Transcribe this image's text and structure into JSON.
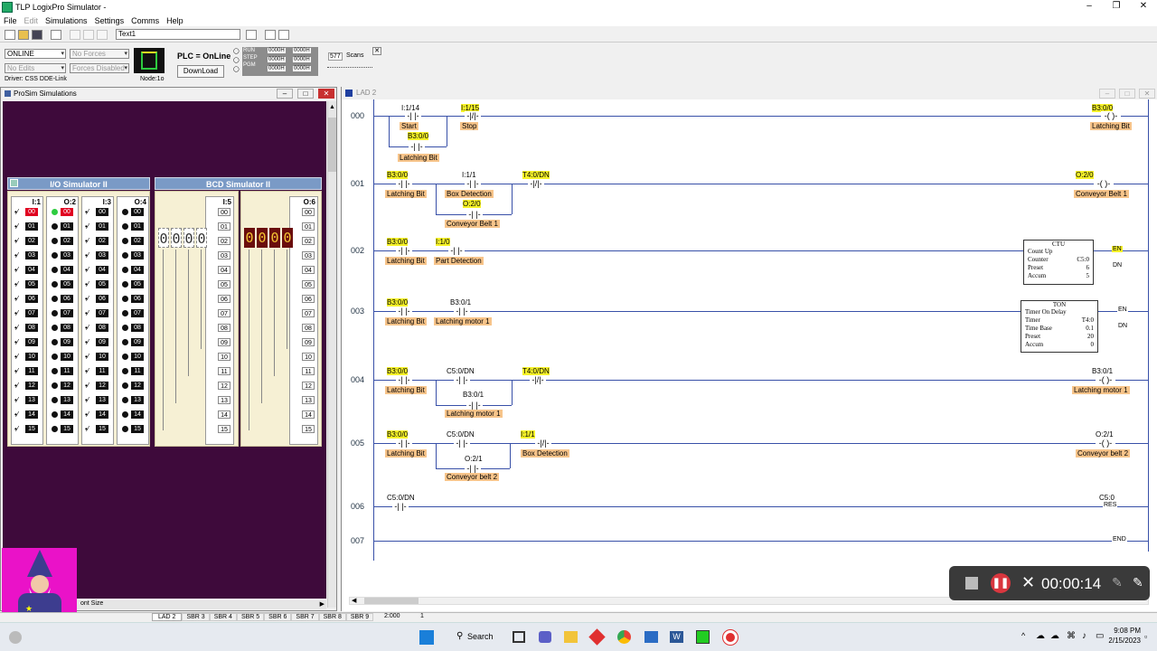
{
  "app": {
    "title": "TLP LogixPro Simulator  -"
  },
  "menu": [
    "File",
    "Edit",
    "Simulations",
    "Settings",
    "Comms",
    "Help"
  ],
  "toolbar": {
    "textbox": "Text1"
  },
  "status": {
    "mode": "ONLINE",
    "forces": "No Forces",
    "edits": "No Edits",
    "forces_disabled": "Forces Disabled",
    "driver": "Driver: CSS DDE-Link",
    "node": "Node:1o",
    "plc": "PLC = OnLine",
    "download": "DownLoad",
    "run": "RUN",
    "step": "STEP",
    "pgm": "PGM",
    "scans_count": "577",
    "scans_label": "Scans",
    "hex": [
      "0000H",
      "0000H",
      "0000H",
      "0000H",
      "0000H",
      "0000H"
    ]
  },
  "prosim": {
    "title": "ProSim Simulations",
    "io_title": "I/O Simulator II",
    "bcd_title": "BCD Simulator II",
    "io_cols": [
      {
        "hdr": "I:1",
        "type": "switch"
      },
      {
        "hdr": "O:2",
        "type": "led"
      },
      {
        "hdr": "I:3",
        "type": "switch"
      },
      {
        "hdr": "O:4",
        "type": "led"
      }
    ],
    "bcd_cols": [
      {
        "hdr": "I:5"
      },
      {
        "hdr": "O:6"
      }
    ],
    "bits": [
      "00",
      "01",
      "02",
      "03",
      "04",
      "05",
      "06",
      "07",
      "08",
      "09",
      "10",
      "11",
      "12",
      "13",
      "14",
      "15"
    ],
    "bcd_in": [
      "0",
      "0",
      "0",
      "0"
    ],
    "bcd_out": [
      "0",
      "0",
      "0",
      "0"
    ],
    "font_size_label": "ont Size"
  },
  "lad": {
    "title": "LAD 2",
    "rungs": [
      "000",
      "001",
      "002",
      "003",
      "004",
      "005",
      "006",
      "007"
    ],
    "r0": {
      "a1": "I:1/14",
      "d1": "Start",
      "a2": "B3:0/0",
      "d2": "Latching Bit",
      "a3": "I:1/15",
      "d3": "Stop",
      "a4": "B3:0/0",
      "d4": "Latching Bit"
    },
    "r1": {
      "a1": "B3:0/0",
      "d1": "Latching Bit",
      "a2": "I:1/1",
      "d2": "Box Detection",
      "a3": "O:2/0",
      "d3": "Conveyor Belt 1",
      "a4": "T4:0/DN",
      "a5": "O:2/0",
      "d5": "Conveyor Belt 1"
    },
    "r2": {
      "a1": "B3:0/0",
      "d1": "Latching Bit",
      "a2": "I:1/0",
      "d2": "Part Detection",
      "ctu": {
        "title": "CTU",
        "name": "Count Up",
        "k1": "Counter",
        "v1": "C5:0",
        "k2": "Preset",
        "v2": "6",
        "k3": "Accum",
        "v3": "5",
        "en": "EN",
        "dn": "DN"
      }
    },
    "r3": {
      "a1": "B3:0/0",
      "d1": "Latching Bit",
      "a2": "B3:0/1",
      "d2": "Latching motor 1",
      "ton": {
        "title": "TON",
        "name": "Timer On Delay",
        "k1": "Timer",
        "v1": "T4:0",
        "k2": "Time Base",
        "v2": "0.1",
        "k3": "Preset",
        "v3": "20",
        "k4": "Accum",
        "v4": "0",
        "en": "EN",
        "dn": "DN"
      }
    },
    "r4": {
      "a1": "B3:0/0",
      "d1": "Latching Bit",
      "a2": "C5:0/DN",
      "a3": "B3:0/1",
      "d3": "Latching motor 1",
      "a4": "T4:0/DN",
      "a5": "B3:0/1",
      "d5": "Latching motor 1"
    },
    "r5": {
      "a1": "B3:0/0",
      "d1": "Latching Bit",
      "a2": "C5:0/DN",
      "a3": "O:2/1",
      "d3": "Conveyor belt 2",
      "a4": "I:1/1",
      "d4": "Box Detection",
      "a5": "O:2/1",
      "d5": "Conveyor belt 2"
    },
    "r6": {
      "a1": "C5:0/DN",
      "a2": "C5:0",
      "res": "RES"
    },
    "r7": {
      "end": "END"
    },
    "status_left": "2:000",
    "status_right": "1"
  },
  "tabs": [
    "LAD 2",
    "SBR 3",
    "SBR 4",
    "SBR 5",
    "SBR 6",
    "SBR 7",
    "SBR 8",
    "SBR 9"
  ],
  "recorder": {
    "time": "00:00:14"
  },
  "taskbar": {
    "search": "Search",
    "time": "9:08 PM",
    "date": "2/15/2023"
  }
}
